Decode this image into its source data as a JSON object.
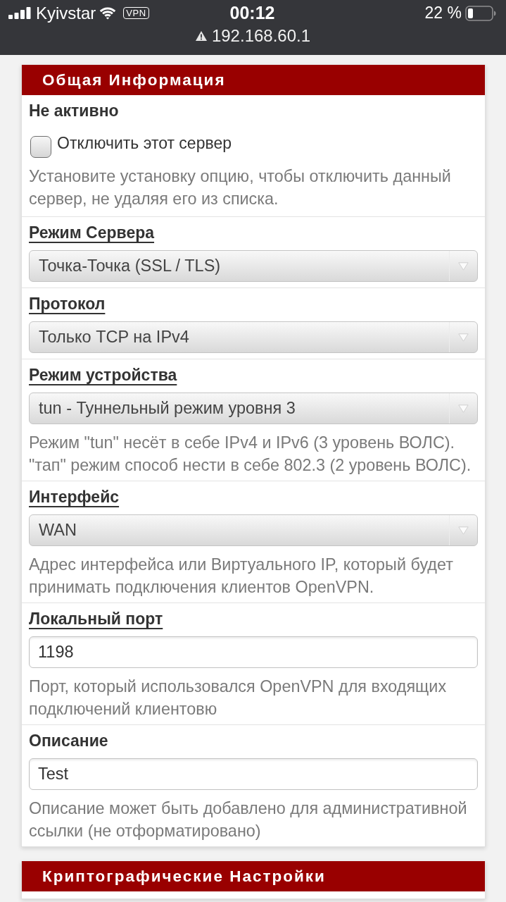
{
  "status_bar": {
    "carrier": "Kyivstar",
    "vpn": "VPN",
    "time": "00:12",
    "battery": "22 %",
    "address": "192.168.60.1"
  },
  "sections": [
    {
      "title": "Общая Информация",
      "fields": [
        {
          "kind": "checkbox",
          "label": "Не активно",
          "underlined": false,
          "option": "Отключить этот сервер",
          "checked": false,
          "help": "Установите установку опцию, чтобы отключить данный сервер, не удаляя его из списка."
        },
        {
          "kind": "select",
          "label": "Режим Сервера",
          "underlined": true,
          "value": "Точка-Точка (SSL / TLS)"
        },
        {
          "kind": "select",
          "label": "Протокол",
          "underlined": true,
          "value": "Только TCP на IPv4"
        },
        {
          "kind": "select",
          "label": "Режим устройства",
          "underlined": true,
          "value": "tun - Туннельный режим уровня 3",
          "help": "Режим \"tun\" несёт в себе IPv4 и IPv6 (3 уровень ВОЛС). \"тап\" режим способ нести в себе 802.3 (2 уровень ВОЛС)."
        },
        {
          "kind": "select",
          "label": "Интерфейс",
          "underlined": true,
          "value": "WAN",
          "help": "Адрес интерфейса или Виртуального IP, который будет принимать подключения клиентов OpenVPN."
        },
        {
          "kind": "input",
          "label": "Локальный порт",
          "underlined": true,
          "value": "1198",
          "help": "Порт, который использовался OpenVPN для входящих подключений клиентовю"
        },
        {
          "kind": "input",
          "label": "Описание",
          "underlined": false,
          "value": "Test",
          "help": "Описание может быть добавлено для административной ссылки (не отформатировано)"
        }
      ]
    },
    {
      "title": "Криптографические Настройки"
    }
  ]
}
